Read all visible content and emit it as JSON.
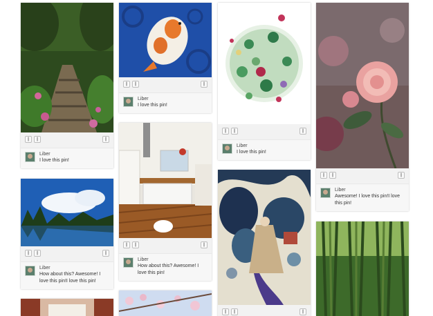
{
  "buttons": {
    "left": "||",
    "mid": "||",
    "right": "||"
  },
  "pins": [
    {
      "id": "forest-path",
      "user": "Liber",
      "comment": "I love this pin!"
    },
    {
      "id": "koi-fish",
      "user": "Liber",
      "comment": "I love this pin!"
    },
    {
      "id": "wreath",
      "user": "Liber",
      "comment": "I love this pin!"
    },
    {
      "id": "rose",
      "user": "Liber",
      "comment": "Awesome! I love this pin!I love this pin!"
    },
    {
      "id": "lake-mountains",
      "user": "Liber",
      "comment": "How about this? Awesome! I love this pin!I love this pin!"
    },
    {
      "id": "kitchen",
      "user": "Liber",
      "comment": "How about this? Awesome! I love this pin!"
    },
    {
      "id": "asian-art",
      "user": "",
      "comment": ""
    },
    {
      "id": "bamboo",
      "user": "",
      "comment": ""
    },
    {
      "id": "curtains",
      "user": "",
      "comment": ""
    },
    {
      "id": "blossoms",
      "user": "",
      "comment": ""
    }
  ]
}
